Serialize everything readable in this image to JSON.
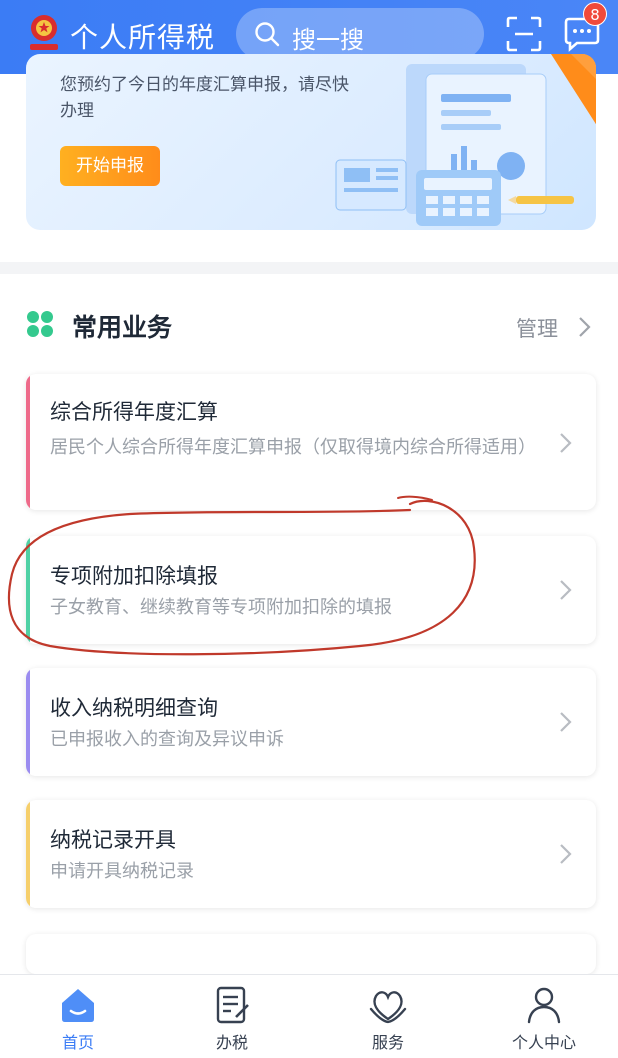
{
  "header": {
    "app_title": "个人所得税",
    "search_placeholder": "搜一搜",
    "message_count": "8",
    "accent_color": "#3b7cf5"
  },
  "banner": {
    "text": "您预约了今日的年度汇算申报，请尽快办理",
    "button_label": "开始申报"
  },
  "section": {
    "title": "常用业务",
    "manage_label": "管理"
  },
  "cards": [
    {
      "title": "综合所得年度汇算",
      "desc": "居民个人综合所得年度汇算申报（仅取得境内综合所得适用）",
      "accent": "#ee6a8a"
    },
    {
      "title": "专项附加扣除填报",
      "desc": "子女教育、继续教育等专项附加扣除的填报",
      "accent": "#4fd1a5"
    },
    {
      "title": "收入纳税明细查询",
      "desc": "已申报收入的查询及异议申诉",
      "accent": "#9b8cf0"
    },
    {
      "title": "纳税记录开具",
      "desc": "申请开具纳税记录",
      "accent": "#f6cf6b"
    }
  ],
  "bottom_nav": [
    {
      "label": "首页",
      "icon": "home-icon",
      "active": true
    },
    {
      "label": "办税",
      "icon": "tax-form-icon",
      "active": false
    },
    {
      "label": "服务",
      "icon": "service-heart-icon",
      "active": false
    },
    {
      "label": "个人中心",
      "icon": "person-icon",
      "active": false
    }
  ]
}
